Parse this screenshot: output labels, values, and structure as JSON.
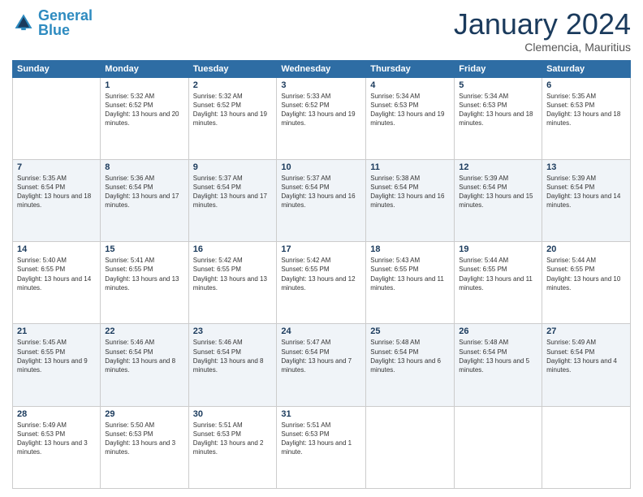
{
  "logo": {
    "text_general": "General",
    "text_blue": "Blue"
  },
  "header": {
    "month": "January 2024",
    "location": "Clemencia, Mauritius"
  },
  "weekdays": [
    "Sunday",
    "Monday",
    "Tuesday",
    "Wednesday",
    "Thursday",
    "Friday",
    "Saturday"
  ],
  "weeks": [
    [
      {
        "day": "",
        "sunrise": "",
        "sunset": "",
        "daylight": ""
      },
      {
        "day": "1",
        "sunrise": "Sunrise: 5:32 AM",
        "sunset": "Sunset: 6:52 PM",
        "daylight": "Daylight: 13 hours and 20 minutes."
      },
      {
        "day": "2",
        "sunrise": "Sunrise: 5:32 AM",
        "sunset": "Sunset: 6:52 PM",
        "daylight": "Daylight: 13 hours and 19 minutes."
      },
      {
        "day": "3",
        "sunrise": "Sunrise: 5:33 AM",
        "sunset": "Sunset: 6:52 PM",
        "daylight": "Daylight: 13 hours and 19 minutes."
      },
      {
        "day": "4",
        "sunrise": "Sunrise: 5:34 AM",
        "sunset": "Sunset: 6:53 PM",
        "daylight": "Daylight: 13 hours and 19 minutes."
      },
      {
        "day": "5",
        "sunrise": "Sunrise: 5:34 AM",
        "sunset": "Sunset: 6:53 PM",
        "daylight": "Daylight: 13 hours and 18 minutes."
      },
      {
        "day": "6",
        "sunrise": "Sunrise: 5:35 AM",
        "sunset": "Sunset: 6:53 PM",
        "daylight": "Daylight: 13 hours and 18 minutes."
      }
    ],
    [
      {
        "day": "7",
        "sunrise": "Sunrise: 5:35 AM",
        "sunset": "Sunset: 6:54 PM",
        "daylight": "Daylight: 13 hours and 18 minutes."
      },
      {
        "day": "8",
        "sunrise": "Sunrise: 5:36 AM",
        "sunset": "Sunset: 6:54 PM",
        "daylight": "Daylight: 13 hours and 17 minutes."
      },
      {
        "day": "9",
        "sunrise": "Sunrise: 5:37 AM",
        "sunset": "Sunset: 6:54 PM",
        "daylight": "Daylight: 13 hours and 17 minutes."
      },
      {
        "day": "10",
        "sunrise": "Sunrise: 5:37 AM",
        "sunset": "Sunset: 6:54 PM",
        "daylight": "Daylight: 13 hours and 16 minutes."
      },
      {
        "day": "11",
        "sunrise": "Sunrise: 5:38 AM",
        "sunset": "Sunset: 6:54 PM",
        "daylight": "Daylight: 13 hours and 16 minutes."
      },
      {
        "day": "12",
        "sunrise": "Sunrise: 5:39 AM",
        "sunset": "Sunset: 6:54 PM",
        "daylight": "Daylight: 13 hours and 15 minutes."
      },
      {
        "day": "13",
        "sunrise": "Sunrise: 5:39 AM",
        "sunset": "Sunset: 6:54 PM",
        "daylight": "Daylight: 13 hours and 14 minutes."
      }
    ],
    [
      {
        "day": "14",
        "sunrise": "Sunrise: 5:40 AM",
        "sunset": "Sunset: 6:55 PM",
        "daylight": "Daylight: 13 hours and 14 minutes."
      },
      {
        "day": "15",
        "sunrise": "Sunrise: 5:41 AM",
        "sunset": "Sunset: 6:55 PM",
        "daylight": "Daylight: 13 hours and 13 minutes."
      },
      {
        "day": "16",
        "sunrise": "Sunrise: 5:42 AM",
        "sunset": "Sunset: 6:55 PM",
        "daylight": "Daylight: 13 hours and 13 minutes."
      },
      {
        "day": "17",
        "sunrise": "Sunrise: 5:42 AM",
        "sunset": "Sunset: 6:55 PM",
        "daylight": "Daylight: 13 hours and 12 minutes."
      },
      {
        "day": "18",
        "sunrise": "Sunrise: 5:43 AM",
        "sunset": "Sunset: 6:55 PM",
        "daylight": "Daylight: 13 hours and 11 minutes."
      },
      {
        "day": "19",
        "sunrise": "Sunrise: 5:44 AM",
        "sunset": "Sunset: 6:55 PM",
        "daylight": "Daylight: 13 hours and 11 minutes."
      },
      {
        "day": "20",
        "sunrise": "Sunrise: 5:44 AM",
        "sunset": "Sunset: 6:55 PM",
        "daylight": "Daylight: 13 hours and 10 minutes."
      }
    ],
    [
      {
        "day": "21",
        "sunrise": "Sunrise: 5:45 AM",
        "sunset": "Sunset: 6:55 PM",
        "daylight": "Daylight: 13 hours and 9 minutes."
      },
      {
        "day": "22",
        "sunrise": "Sunrise: 5:46 AM",
        "sunset": "Sunset: 6:54 PM",
        "daylight": "Daylight: 13 hours and 8 minutes."
      },
      {
        "day": "23",
        "sunrise": "Sunrise: 5:46 AM",
        "sunset": "Sunset: 6:54 PM",
        "daylight": "Daylight: 13 hours and 8 minutes."
      },
      {
        "day": "24",
        "sunrise": "Sunrise: 5:47 AM",
        "sunset": "Sunset: 6:54 PM",
        "daylight": "Daylight: 13 hours and 7 minutes."
      },
      {
        "day": "25",
        "sunrise": "Sunrise: 5:48 AM",
        "sunset": "Sunset: 6:54 PM",
        "daylight": "Daylight: 13 hours and 6 minutes."
      },
      {
        "day": "26",
        "sunrise": "Sunrise: 5:48 AM",
        "sunset": "Sunset: 6:54 PM",
        "daylight": "Daylight: 13 hours and 5 minutes."
      },
      {
        "day": "27",
        "sunrise": "Sunrise: 5:49 AM",
        "sunset": "Sunset: 6:54 PM",
        "daylight": "Daylight: 13 hours and 4 minutes."
      }
    ],
    [
      {
        "day": "28",
        "sunrise": "Sunrise: 5:49 AM",
        "sunset": "Sunset: 6:53 PM",
        "daylight": "Daylight: 13 hours and 3 minutes."
      },
      {
        "day": "29",
        "sunrise": "Sunrise: 5:50 AM",
        "sunset": "Sunset: 6:53 PM",
        "daylight": "Daylight: 13 hours and 3 minutes."
      },
      {
        "day": "30",
        "sunrise": "Sunrise: 5:51 AM",
        "sunset": "Sunset: 6:53 PM",
        "daylight": "Daylight: 13 hours and 2 minutes."
      },
      {
        "day": "31",
        "sunrise": "Sunrise: 5:51 AM",
        "sunset": "Sunset: 6:53 PM",
        "daylight": "Daylight: 13 hours and 1 minute."
      },
      {
        "day": "",
        "sunrise": "",
        "sunset": "",
        "daylight": ""
      },
      {
        "day": "",
        "sunrise": "",
        "sunset": "",
        "daylight": ""
      },
      {
        "day": "",
        "sunrise": "",
        "sunset": "",
        "daylight": ""
      }
    ]
  ]
}
